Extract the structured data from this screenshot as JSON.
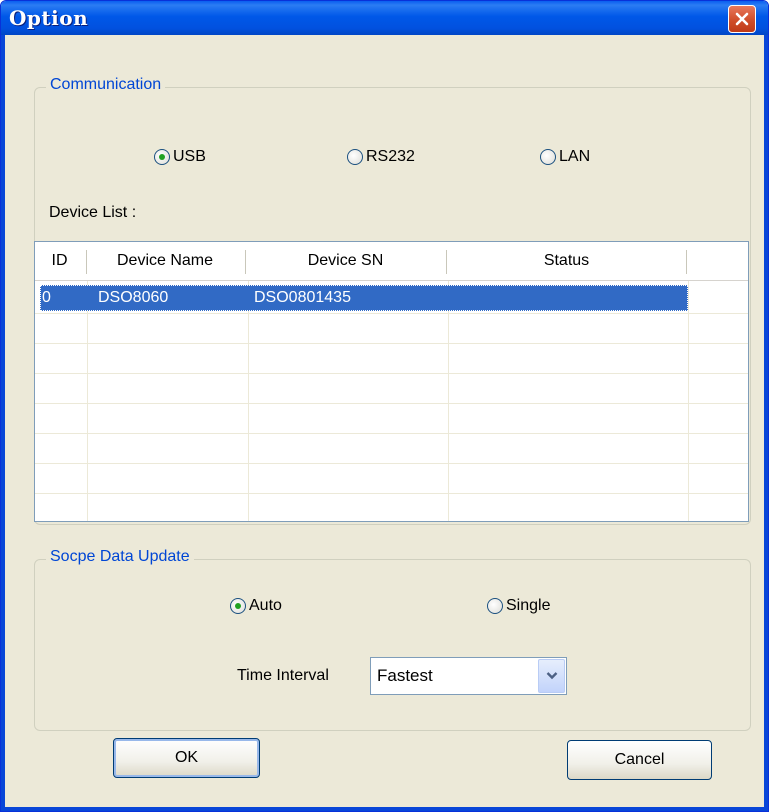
{
  "window": {
    "title": "Option"
  },
  "communication": {
    "legend": "Communication",
    "options": [
      "USB",
      "RS232",
      "LAN"
    ],
    "selected": "USB",
    "device_list_label": "Device List :"
  },
  "device_table": {
    "headers": [
      "ID",
      "Device Name",
      "Device SN",
      "Status"
    ],
    "rows": [
      {
        "id": "0",
        "name": "DSO8060",
        "sn": "DSO0801435",
        "status": ""
      }
    ],
    "selected_row": 0
  },
  "scope_update": {
    "legend": "Socpe Data Update",
    "options": [
      "Auto",
      "Single"
    ],
    "selected": "Auto",
    "interval_label": "Time Interval",
    "interval_value": "Fastest"
  },
  "buttons": {
    "ok": "OK",
    "cancel": "Cancel"
  },
  "icons": {
    "close": "close-icon",
    "dropdown": "chevron-down-icon"
  },
  "colors": {
    "titlebar": "#0058e8",
    "legend_text": "#0046d5",
    "selection": "#316ac5",
    "close_button": "#d04e2a"
  }
}
